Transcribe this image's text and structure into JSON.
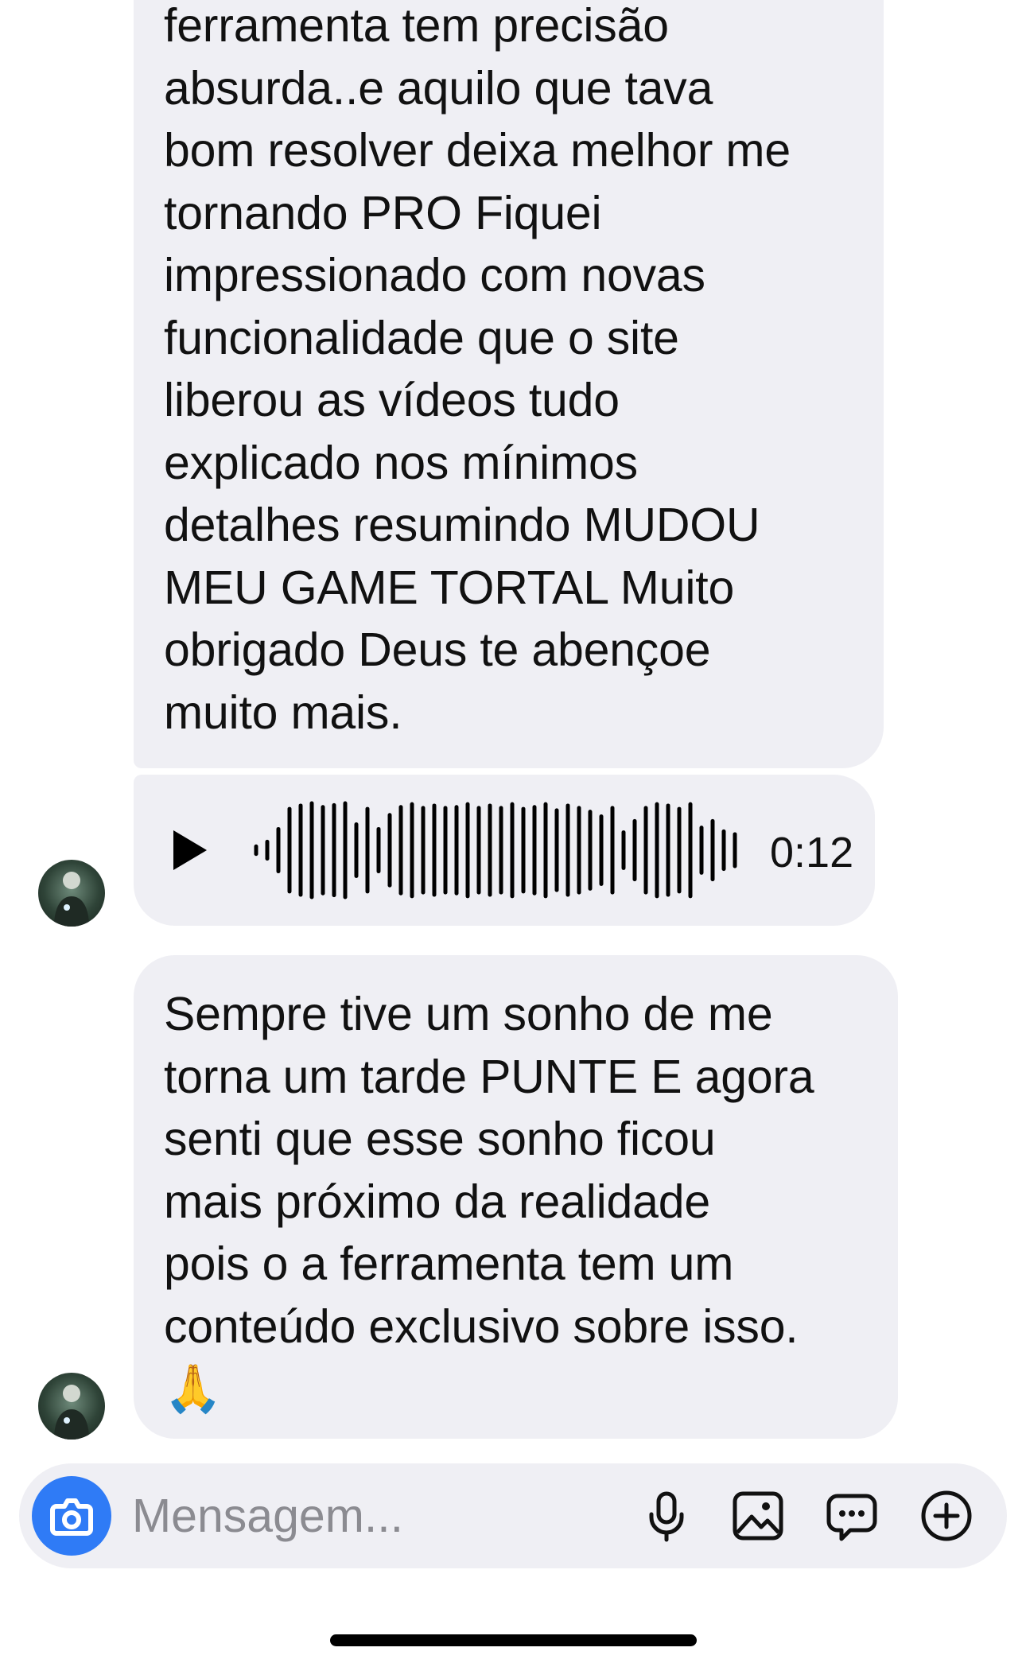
{
  "conversation": {
    "messages": [
      {
        "type": "text",
        "text": "ferramenta tem precisão\nabsurda..e aquilo que tava\nbom resolver deixa melhor me\ntornando PRO Fiquei\nimpressionado com novas\nfuncionalidade que o site\nliberou as vídeos tudo\nexplicado nos mínimos\ndetalhes resumindo MUDOU\nMEU GAME TORTAL Muito\nobrigado Deus te abençoe\nmuito mais."
      },
      {
        "type": "audio",
        "duration": "0:12",
        "waveform": [
          0.08,
          0.18,
          0.45,
          0.88,
          0.95,
          1.0,
          0.92,
          0.96,
          1.0,
          0.55,
          0.88,
          0.45,
          0.75,
          0.92,
          0.98,
          0.9,
          0.95,
          0.9,
          0.92,
          0.98,
          0.9,
          0.95,
          0.9,
          0.98,
          0.88,
          0.92,
          0.98,
          0.85,
          0.95,
          0.9,
          0.82,
          0.72,
          0.9,
          0.38,
          0.62,
          0.9,
          0.98,
          0.95,
          0.88,
          0.98,
          0.48,
          0.62,
          0.4,
          0.34
        ]
      },
      {
        "type": "text",
        "text": "Sempre tive um sonho de me\ntorna um tarde PUNTE E agora\nsenti que esse sonho ficou\nmais próximo da realidade\npois o a ferramenta tem um\nconteúdo exclusivo sobre isso.",
        "emoji": "🙏"
      }
    ]
  },
  "composer": {
    "placeholder": "Mensagem..."
  },
  "icons": {
    "camera": "camera-icon",
    "microphone": "microphone-icon",
    "gallery": "gallery-icon",
    "sticker": "chat-bubble-icon",
    "add": "plus-circle-icon"
  },
  "colors": {
    "bubble": "#efeff4",
    "accent": "#2f7bf6",
    "placeholder": "#8b8b91"
  }
}
